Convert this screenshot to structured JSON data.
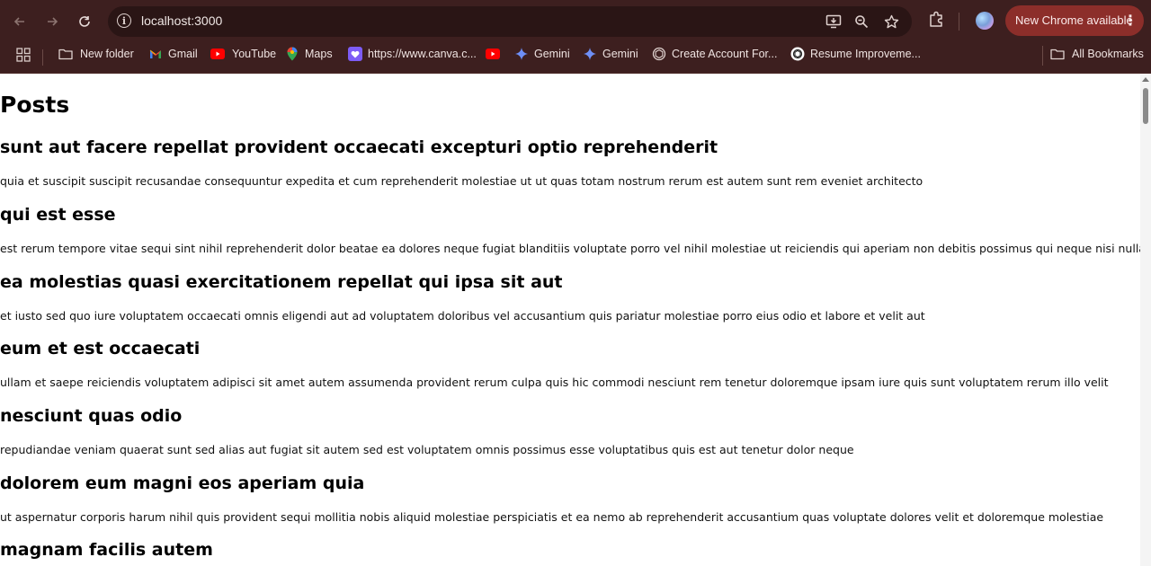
{
  "browser": {
    "url": "localhost:3000",
    "update_button": "New Chrome available",
    "bookmarks": [
      {
        "label": "New folder",
        "icon": "folder-icon"
      },
      {
        "label": "Gmail",
        "icon": "gmail-icon"
      },
      {
        "label": "YouTube",
        "icon": "youtube-icon"
      },
      {
        "label": "Maps",
        "icon": "maps-icon"
      },
      {
        "label": "https://www.canva.c...",
        "icon": "canva-icon"
      },
      {
        "label": "",
        "icon": "youtube-icon"
      },
      {
        "label": "Gemini",
        "icon": "gemini-icon"
      },
      {
        "label": "Gemini",
        "icon": "gemini-icon"
      },
      {
        "label": "Create Account For...",
        "icon": "openai-icon"
      },
      {
        "label": "Resume Improveme...",
        "icon": "openai-icon"
      }
    ],
    "all_bookmarks": "All Bookmarks",
    "colors": {
      "chrome_bg": "#3d1f1f",
      "omnibox_bg": "#2a1515",
      "update_bg": "#8c2e2a"
    }
  },
  "page": {
    "heading": "Posts",
    "posts": [
      {
        "title": "sunt aut facere repellat provident occaecati excepturi optio reprehenderit",
        "body": "quia et suscipit suscipit recusandae consequuntur expedita et cum reprehenderit molestiae ut ut quas totam nostrum rerum est autem sunt rem eveniet architecto"
      },
      {
        "title": "qui est esse",
        "body": "est rerum tempore vitae sequi sint nihil reprehenderit dolor beatae ea dolores neque fugiat blanditiis voluptate porro vel nihil molestiae ut reiciendis qui aperiam non debitis possimus qui neque nisi nulla"
      },
      {
        "title": "ea molestias quasi exercitationem repellat qui ipsa sit aut",
        "body": "et iusto sed quo iure voluptatem occaecati omnis eligendi aut ad voluptatem doloribus vel accusantium quis pariatur molestiae porro eius odio et labore et velit aut"
      },
      {
        "title": "eum et est occaecati",
        "body": "ullam et saepe reiciendis voluptatem adipisci sit amet autem assumenda provident rerum culpa quis hic commodi nesciunt rem tenetur doloremque ipsam iure quis sunt voluptatem rerum illo velit"
      },
      {
        "title": "nesciunt quas odio",
        "body": "repudiandae veniam quaerat sunt sed alias aut fugiat sit autem sed est voluptatem omnis possimus esse voluptatibus quis est aut tenetur dolor neque"
      },
      {
        "title": "dolorem eum magni eos aperiam quia",
        "body": "ut aspernatur corporis harum nihil quis provident sequi mollitia nobis aliquid molestiae perspiciatis et ea nemo ab reprehenderit accusantium quas voluptate dolores velit et doloremque molestiae"
      },
      {
        "title": "magnam facilis autem",
        "body": ""
      }
    ]
  }
}
